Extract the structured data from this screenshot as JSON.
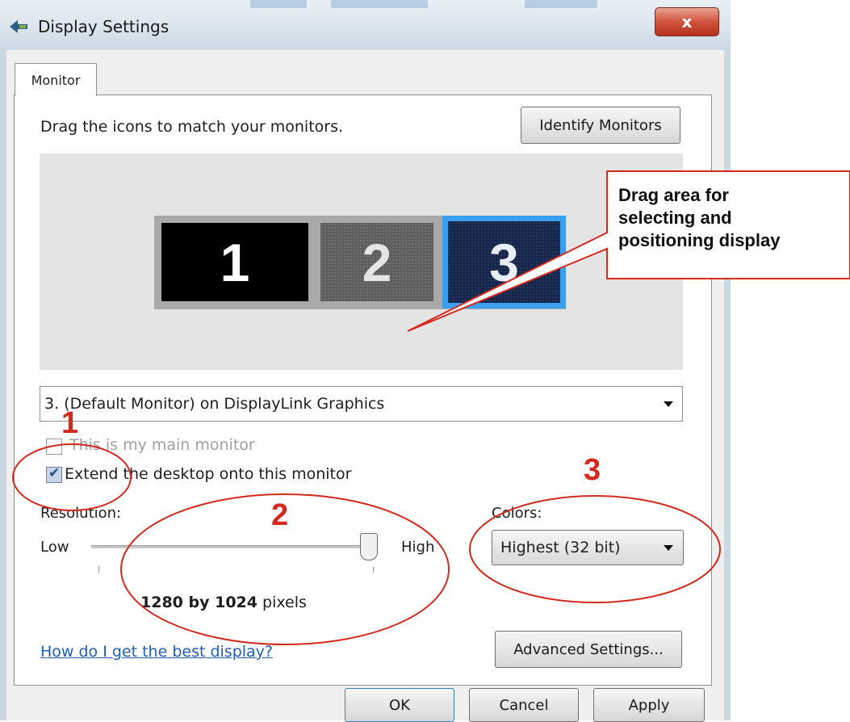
{
  "window": {
    "title": "Display Settings",
    "close_glyph": "x",
    "icon": "display-settings-icon"
  },
  "tabs": [
    {
      "label": "Monitor",
      "active": true
    }
  ],
  "monitor_tab": {
    "instruction": "Drag the icons to match your monitors.",
    "identify_label": "Identify Monitors",
    "monitors": [
      {
        "label": "1",
        "selected": false
      },
      {
        "label": "2",
        "selected": false
      },
      {
        "label": "3",
        "selected": true
      }
    ],
    "monitor_select_value": "3. (Default Monitor) on DisplayLink Graphics",
    "main_monitor_label": "This is my main monitor",
    "main_monitor_checked": false,
    "main_monitor_enabled": false,
    "extend_label": "Extend the desktop onto this monitor",
    "extend_checked": true,
    "resolution_label": "Resolution:",
    "low_label": "Low",
    "high_label": "High",
    "resolution_value": "1280 by 1024",
    "resolution_unit": "pixels",
    "colors_label": "Colors:",
    "colors_value": "Highest (32 bit)",
    "help_link": "How do I get the best display?",
    "advanced_label": "Advanced Settings..."
  },
  "footer": {
    "ok_label": "OK",
    "cancel_label": "Cancel",
    "apply_label": "Apply"
  },
  "annotations": {
    "callout_line1": "Drag area for",
    "callout_line2": "selecting and",
    "callout_line3": "positioning display",
    "num1": "1",
    "num2": "2",
    "num3": "3",
    "color": "#d42a1e"
  },
  "colors": {
    "selected_monitor_border": "#3aa0ee",
    "link": "#1f5fb5"
  }
}
